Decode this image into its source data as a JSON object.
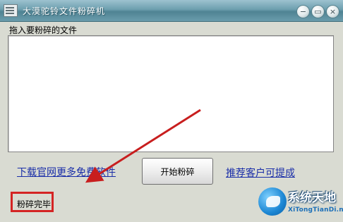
{
  "window": {
    "title": "大漠驼铃文件粉碎机",
    "controls": {
      "minimize": "−",
      "restore": "▭",
      "close": "×"
    }
  },
  "file_panel": {
    "label": "拖入要粉碎的文件",
    "files": []
  },
  "actions": {
    "download_link": "下载官网更多免费软件",
    "start_button": "开始粉碎",
    "feedback_link": "推荐客户可提成"
  },
  "status": {
    "text": "粉碎完毕"
  },
  "watermark": {
    "title": "系统天地",
    "url": "XiTongTianDi.net"
  },
  "colors": {
    "titlebar": "#5f93a3",
    "highlight": "#d42424",
    "link": "#1a2ea8"
  },
  "icons": {
    "app": "shredder-icon",
    "minimize": "minimize-icon",
    "restore": "restore-icon",
    "close": "close-icon"
  }
}
